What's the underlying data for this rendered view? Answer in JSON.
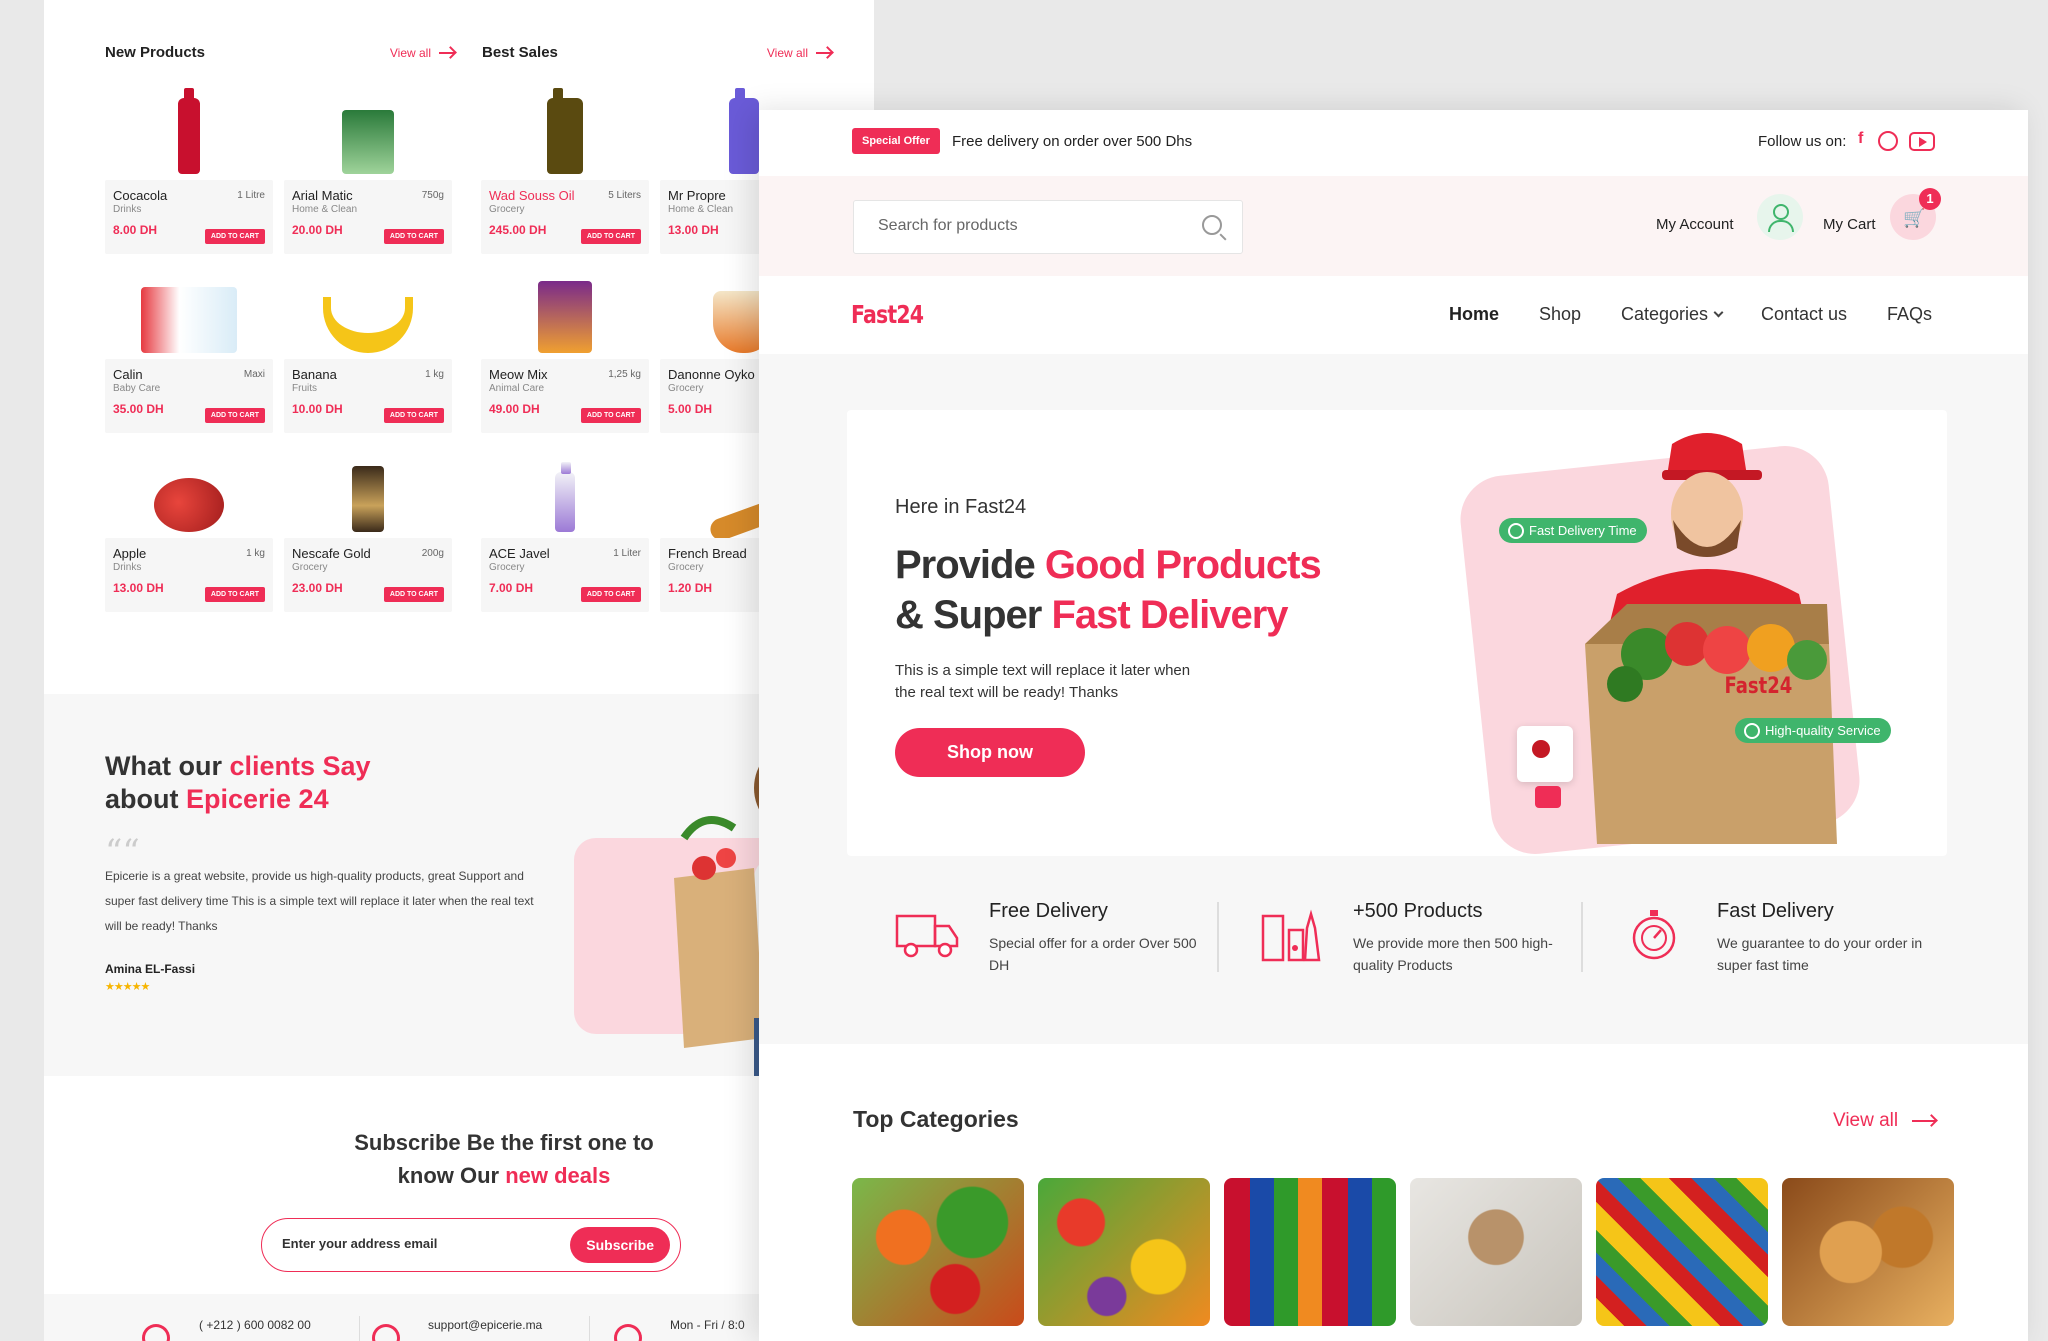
{
  "back": {
    "new_products": {
      "title": "New Products",
      "view_all": "View all"
    },
    "best_sales": {
      "title": "Best Sales",
      "view_all": "View all"
    },
    "products": [
      {
        "name": "Cocacola",
        "qty": "1 Litre",
        "category": "Drinks",
        "price": "8.00 DH",
        "cta": "ADD TO CART"
      },
      {
        "name": "Arial Matic",
        "qty": "750g",
        "category": "Home & Clean",
        "price": "20.00 DH",
        "cta": "ADD TO CART"
      },
      {
        "name": "Wad Souss Oil",
        "qty": "5 Liters",
        "category": "Grocery",
        "price": "245.00 DH",
        "cta": "ADD TO CART"
      },
      {
        "name": "Mr Propre",
        "qty": "",
        "category": "Home & Clean",
        "price": "13.00 DH",
        "cta": ""
      },
      {
        "name": "Calin",
        "qty": "Maxi",
        "category": "Baby Care",
        "price": "35.00 DH",
        "cta": "ADD TO CART"
      },
      {
        "name": "Banana",
        "qty": "1 kg",
        "category": "Fruits",
        "price": "10.00 DH",
        "cta": "ADD TO CART"
      },
      {
        "name": "Meow Mix",
        "qty": "1,25 kg",
        "category": "Animal Care",
        "price": "49.00 DH",
        "cta": "ADD TO CART"
      },
      {
        "name": "Danonne Oyko",
        "qty": "",
        "category": "Grocery",
        "price": "5.00 DH",
        "cta": ""
      },
      {
        "name": "Apple",
        "qty": "1 kg",
        "category": "Drinks",
        "price": "13.00 DH",
        "cta": "ADD TO CART"
      },
      {
        "name": "Nescafe Gold",
        "qty": "200g",
        "category": "Grocery",
        "price": "23.00 DH",
        "cta": "ADD TO CART"
      },
      {
        "name": "ACE Javel",
        "qty": "1 Liter",
        "category": "Grocery",
        "price": "7.00 DH",
        "cta": "ADD TO CART"
      },
      {
        "name": "French Bread",
        "qty": "",
        "category": "Grocery",
        "price": "1.20 DH",
        "cta": ""
      }
    ],
    "testimonial": {
      "title_a": "What our ",
      "title_red_a": "clients Say",
      "title_b": "about ",
      "title_red_b": "Epicerie 24",
      "quote_mark": "““",
      "text": "Epicerie is a great website, provide us high-quality products, great Support and  super fast delivery time This is a simple text will replace it later when the real text will be ready! Thanks",
      "author": "Amina EL-Fassi",
      "stars": "★★★★★"
    },
    "subscribe": {
      "title_a": "Subscribe Be the first one to",
      "title_b": "know Our ",
      "title_red": "new deals",
      "placeholder": "Enter your address email",
      "button": "Subscribe"
    },
    "footer": {
      "phone": "( +212 ) 600 0082 00",
      "email": "support@epicerie.ma",
      "hours": "Mon - Fri / 8:0"
    }
  },
  "front": {
    "topbar": {
      "badge": "Special Offer",
      "offer": "Free delivery on order over 500 Dhs",
      "follow": "Follow us on:"
    },
    "search": {
      "placeholder": "Search for products"
    },
    "account": {
      "label": "My Account"
    },
    "cart": {
      "label": "My Cart",
      "count": "1"
    },
    "logo": "Fast24",
    "nav": {
      "home": "Home",
      "shop": "Shop",
      "categories": "Categories",
      "contact": "Contact us",
      "faqs": "FAQs"
    },
    "hero": {
      "subtitle": "Here in Fast24",
      "line1_a": "Provide ",
      "line1_red": "Good Products",
      "line2_a": "& Super ",
      "line2_red": "Fast Delivery",
      "desc_a": "This is a simple text will replace it later when",
      "desc_b": " the real text will be ready! Thanks",
      "button": "Shop now",
      "tag1": "Fast Delivery Time",
      "tag2": "High-quality Service",
      "box_logo": "Fast24"
    },
    "features": [
      {
        "title": "Free Delivery",
        "desc": "Special offer for a order Over 500 DH"
      },
      {
        "title": "+500 Products",
        "desc": "We provide more then 500 high-quality Products"
      },
      {
        "title": "Fast Delivery",
        "desc": "We guarantee to do your order in super fast time"
      }
    ],
    "top_categories": {
      "title": "Top Categories",
      "view_all": "View all"
    },
    "colors": {
      "accent": "#ef2d56",
      "green": "#3fb56c",
      "pink": "#fbd7de"
    }
  }
}
